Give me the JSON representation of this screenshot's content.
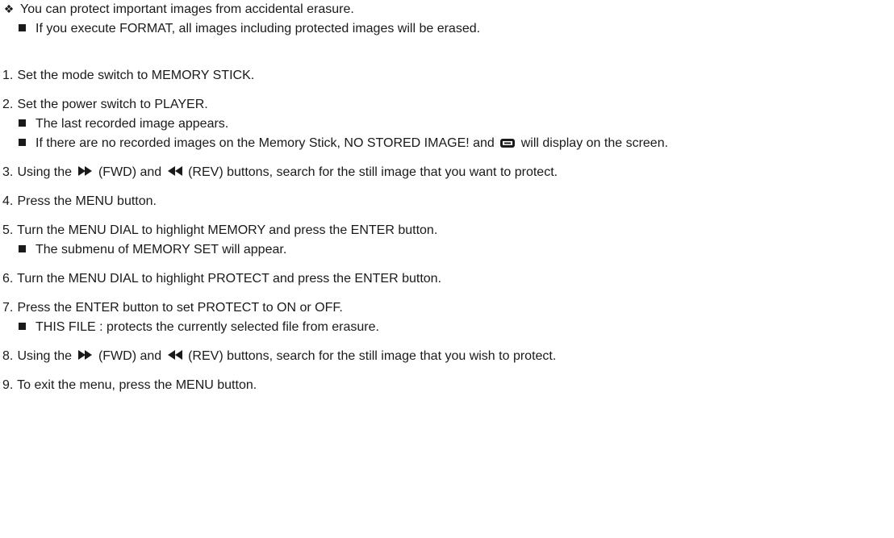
{
  "intro": {
    "main": "You can protect important images from accidental erasure.",
    "note": "If you execute FORMAT, all images including protected images will be erased."
  },
  "steps": [
    {
      "num": "1.",
      "text": "Set the mode switch to MEMORY STICK."
    },
    {
      "num": "2.",
      "text": "Set the power switch to PLAYER.",
      "subs": [
        "The last recorded image appears.",
        "If there are no recorded images on the Memory Stick, NO STORED IMAGE! and",
        "will display on the screen."
      ]
    },
    {
      "num": "3.",
      "text_a": "Using the",
      "text_b": "(FWD) and",
      "text_c": "(REV) buttons, search for the still image that you want to protect."
    },
    {
      "num": "4.",
      "text": "Press the MENU button."
    },
    {
      "num": "5.",
      "text": "Turn the MENU DIAL to highlight MEMORY and press the ENTER button.",
      "subs": [
        "The submenu of MEMORY SET will appear."
      ]
    },
    {
      "num": "6.",
      "text": "Turn the MENU DIAL to highlight PROTECT and press the ENTER button."
    },
    {
      "num": "7.",
      "text": "Press the ENTER button to set PROTECT to ON or OFF.",
      "subs": [
        "THIS FILE : protects the currently selected file from erasure."
      ]
    },
    {
      "num": "8.",
      "text_a": "Using the",
      "text_b": "(FWD) and",
      "text_c": "(REV) buttons, search for the still image that you wish to protect."
    },
    {
      "num": "9.",
      "text": "To exit the menu, press the MENU button."
    }
  ],
  "icons": {
    "intro": "four-petal-diamond-icon",
    "bullet": "square-bullet-icon",
    "fwd": "fast-forward-icon",
    "rev": "rewind-icon",
    "memory": "memory-stick-icon"
  }
}
